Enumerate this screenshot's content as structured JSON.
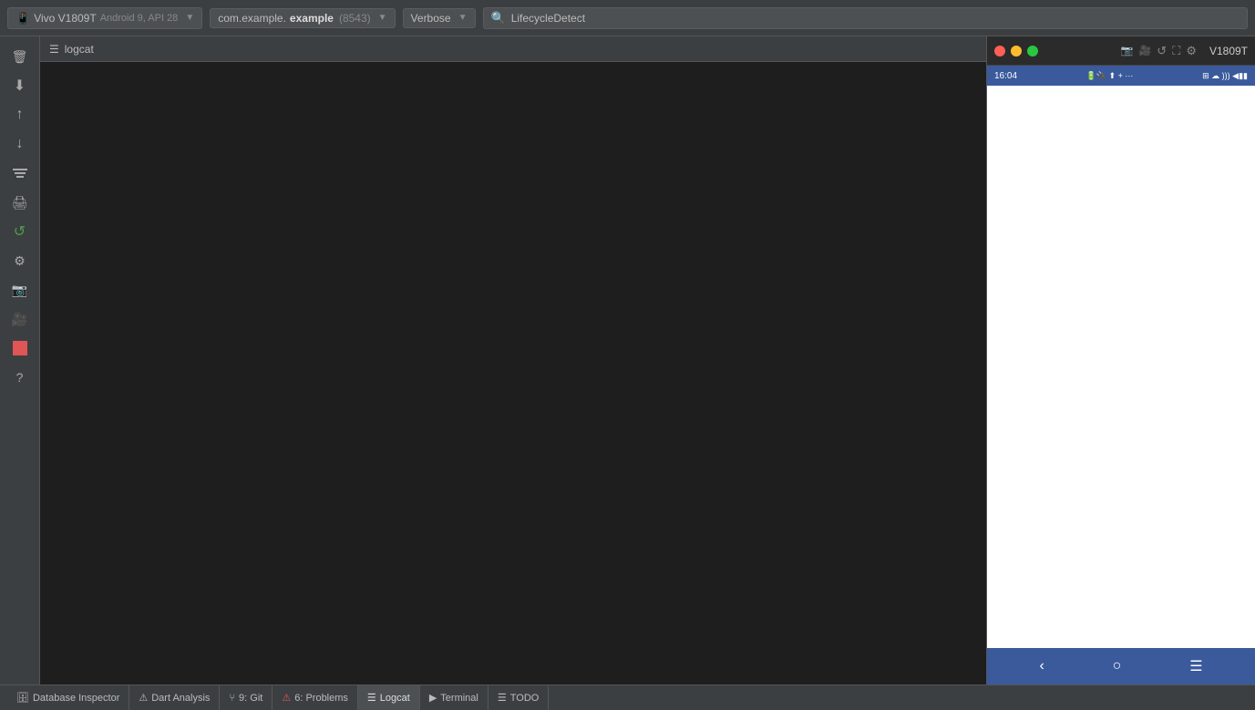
{
  "toolbar": {
    "device_label": "Vivo V1809T",
    "device_sub": "Android 9, API 28",
    "app_package": "com.example.",
    "app_name_bold": "example",
    "app_pid": "(8543)",
    "log_level": "Verbose",
    "search_placeholder": "LifecycleDetect",
    "search_value": "LifecycleDetect"
  },
  "logcat": {
    "title": "logcat"
  },
  "phone": {
    "title": "V1809T",
    "status_time": "16:04",
    "status_right": "▲▼ ☁ ▲ + ···",
    "status_right2": "⌗ ☁ ))) ◀▮▮"
  },
  "bottom_bar": {
    "database_inspector": "Database Inspector",
    "dart_analysis": "Dart Analysis",
    "git": "9: Git",
    "problems": "6: Problems",
    "logcat": "Logcat",
    "terminal": "Terminal",
    "todo": "TODO"
  },
  "sidebar_icons": {
    "delete": "🗑",
    "import": "⬇",
    "up": "↑",
    "down": "↓",
    "filter": "≡",
    "print": "🖨",
    "refresh": "↺",
    "settings": "⚙",
    "camera": "📷",
    "video": "🎥",
    "red_square": "■",
    "help": "?"
  }
}
